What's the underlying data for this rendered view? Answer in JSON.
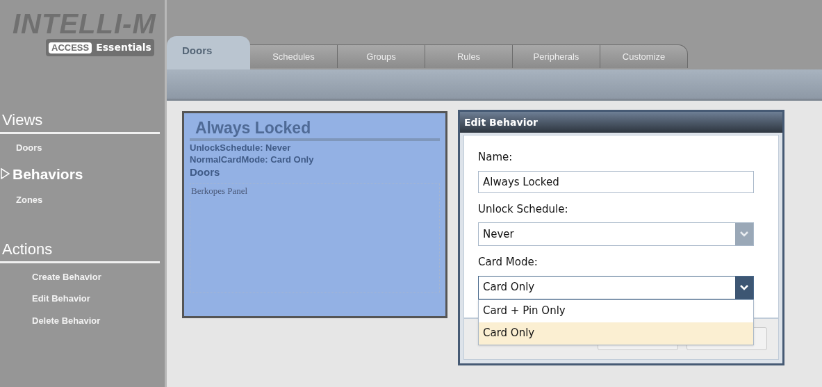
{
  "logo": {
    "title": "INTELLI-M",
    "badge": "ACCESS",
    "subtitle": "Essentials"
  },
  "tabs": [
    {
      "label": "Doors",
      "selected": true
    },
    {
      "label": "Schedules",
      "selected": false
    },
    {
      "label": "Groups",
      "selected": false
    },
    {
      "label": "Rules",
      "selected": false
    },
    {
      "label": "Peripherals",
      "selected": false
    },
    {
      "label": "Customize",
      "selected": false
    }
  ],
  "sidebar": {
    "views": {
      "heading": "Views",
      "items": [
        {
          "label": "Doors",
          "selected": false
        },
        {
          "label": "Behaviors",
          "selected": true
        },
        {
          "label": "Zones",
          "selected": false
        }
      ]
    },
    "actions": {
      "heading": "Actions",
      "items": [
        {
          "label": "Create Behavior"
        },
        {
          "label": "Edit Behavior"
        },
        {
          "label": "Delete Behavior"
        }
      ]
    }
  },
  "behavior_card": {
    "title": "Always Locked",
    "details": [
      "UnlockSchedule: Never",
      "NormalCardMode: Card Only"
    ],
    "doors_heading": "Doors",
    "doors": [
      "Berkopes Panel"
    ]
  },
  "dialog": {
    "title": "Edit Behavior",
    "fields": [
      {
        "kind": "text",
        "label": "Name:",
        "value": "Always Locked"
      },
      {
        "kind": "select",
        "label": "Unlock Schedule:",
        "value": "Never",
        "expanded": false
      },
      {
        "kind": "select",
        "label": "Card Mode:",
        "value": "Card Only",
        "expanded": true,
        "options": [
          {
            "label": "Card + Pin Only",
            "selected": false
          },
          {
            "label": "Card Only",
            "selected": true
          }
        ]
      }
    ]
  }
}
